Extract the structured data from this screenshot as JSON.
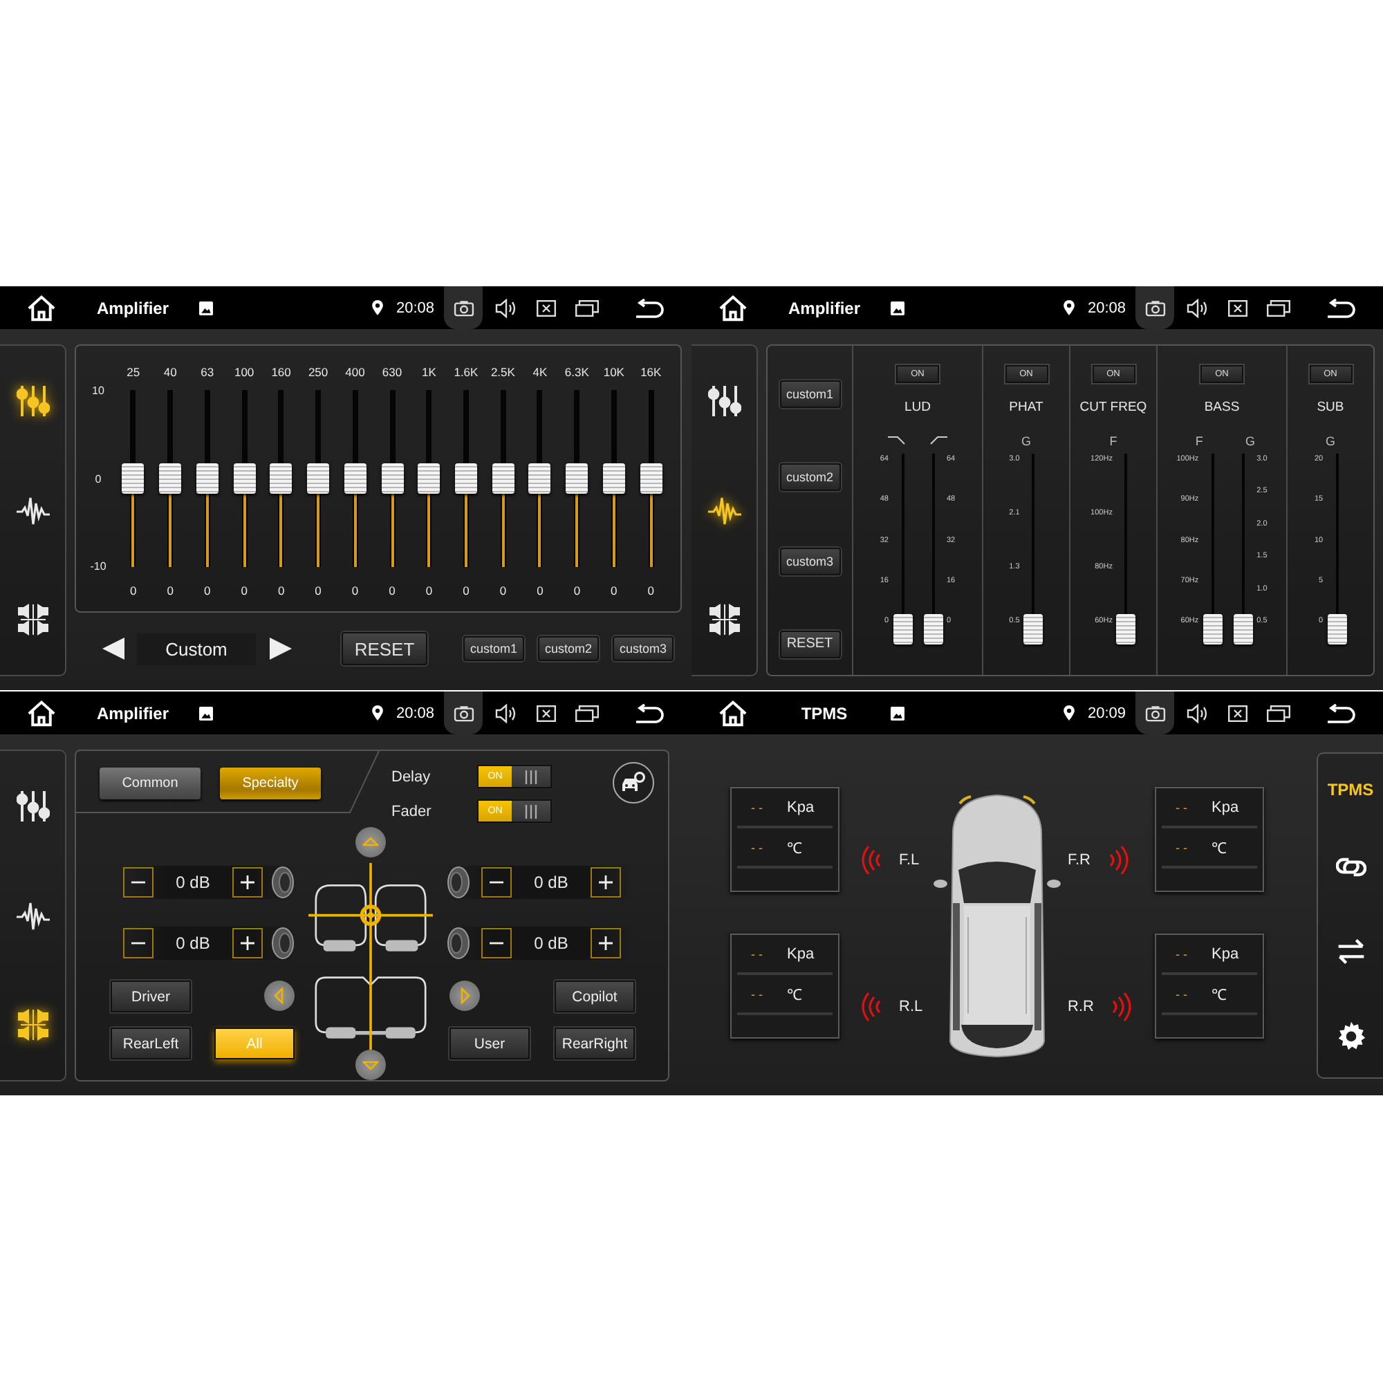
{
  "screens": [
    {
      "kind": "equalizer",
      "status_bar": {
        "title": "Amplifier",
        "time": "20:08"
      },
      "side_tabs": [
        {
          "kind": "sliders",
          "selected": true
        },
        {
          "kind": "waveform",
          "selected": false
        },
        {
          "kind": "balance",
          "selected": false
        }
      ],
      "scale": [
        "10",
        "0",
        "-10"
      ],
      "bands": [
        {
          "freq": "25",
          "value": "0",
          "level": 0.5
        },
        {
          "freq": "40",
          "value": "0",
          "level": 0.5
        },
        {
          "freq": "63",
          "value": "0",
          "level": 0.5
        },
        {
          "freq": "100",
          "value": "0",
          "level": 0.5
        },
        {
          "freq": "160",
          "value": "0",
          "level": 0.5
        },
        {
          "freq": "250",
          "value": "0",
          "level": 0.5
        },
        {
          "freq": "400",
          "value": "0",
          "level": 0.5
        },
        {
          "freq": "630",
          "value": "0",
          "level": 0.5
        },
        {
          "freq": "1K",
          "value": "0",
          "level": 0.5
        },
        {
          "freq": "1.6K",
          "value": "0",
          "level": 0.5
        },
        {
          "freq": "2.5K",
          "value": "0",
          "level": 0.5
        },
        {
          "freq": "4K",
          "value": "0",
          "level": 0.5
        },
        {
          "freq": "6.3K",
          "value": "0",
          "level": 0.5
        },
        {
          "freq": "10K",
          "value": "0",
          "level": 0.5
        },
        {
          "freq": "16K",
          "value": "0",
          "level": 0.5
        }
      ],
      "preset": "Custom",
      "buttons": [
        {
          "label": "RESET",
          "kind": "large"
        },
        {
          "label": "custom1",
          "kind": "small"
        },
        {
          "label": "custom2",
          "kind": "small"
        },
        {
          "label": "custom3",
          "kind": "small"
        }
      ]
    },
    {
      "kind": "amplifier",
      "status_bar": {
        "title": "Amplifier",
        "time": "20:08"
      },
      "side_tabs": [
        {
          "kind": "sliders",
          "selected": false
        },
        {
          "kind": "waveform",
          "selected": true
        },
        {
          "kind": "balance",
          "selected": false
        }
      ],
      "presets": [
        "custom1",
        "custom2",
        "custom3",
        "RESET"
      ],
      "channels": [
        {
          "toggle": "ON",
          "name": "LUD",
          "sliders": [
            {
              "kind": "left",
              "header": {
                "kind": "curve_down"
              },
              "ticks": [
                "64",
                "48",
                "32",
                "16",
                "0"
              ],
              "level": 0
            },
            {
              "kind": "right",
              "header": {
                "kind": "curve_up"
              },
              "ticks": [
                "64",
                "48",
                "32",
                "16",
                "0"
              ],
              "level": 0
            }
          ]
        },
        {
          "toggle": "ON",
          "name": "PHAT",
          "sliders": [
            {
              "kind": "left",
              "header": {
                "kind": "text",
                "text": "G"
              },
              "ticks": [
                "3.0",
                "2.1",
                "1.3",
                "0.5"
              ],
              "level": 0
            }
          ]
        },
        {
          "toggle": "ON",
          "name": "CUT FREQ",
          "sliders": [
            {
              "kind": "left",
              "header": {
                "kind": "text",
                "text": "F"
              },
              "ticks": [
                "120Hz",
                "100Hz",
                "80Hz",
                "60Hz"
              ],
              "level": 0
            }
          ]
        },
        {
          "toggle": "ON",
          "name": "BASS",
          "sliders": [
            {
              "kind": "left",
              "header": {
                "kind": "text",
                "text": "F"
              },
              "ticks": [
                "100Hz",
                "90Hz",
                "80Hz",
                "70Hz",
                "60Hz"
              ],
              "level": 0
            },
            {
              "kind": "right",
              "header": {
                "kind": "text",
                "text": "G"
              },
              "ticks": [
                "3.0",
                "2.5",
                "2.0",
                "1.5",
                "1.0",
                "0.5"
              ],
              "level": 0
            }
          ]
        },
        {
          "toggle": "ON",
          "name": "SUB",
          "sliders": [
            {
              "kind": "left",
              "header": {
                "kind": "text",
                "text": "G"
              },
              "ticks": [
                "20",
                "15",
                "10",
                "5",
                "0"
              ],
              "level": 0
            }
          ]
        }
      ]
    },
    {
      "kind": "balance",
      "status_bar": {
        "title": "Amplifier",
        "time": "20:08"
      },
      "side_tabs": [
        {
          "kind": "sliders",
          "selected": false
        },
        {
          "kind": "waveform",
          "selected": false
        },
        {
          "kind": "balance",
          "selected": true
        }
      ],
      "modes": [
        {
          "label": "Common",
          "selected": false
        },
        {
          "label": "Specialty",
          "selected": true
        }
      ],
      "toggles": [
        {
          "label": "Delay",
          "state": "ON",
          "on": true
        },
        {
          "label": "Fader",
          "state": "ON",
          "on": true
        }
      ],
      "gains": [
        {
          "value": "0 dB"
        },
        {
          "value": "0 dB"
        },
        {
          "value": "0 dB"
        },
        {
          "value": "0 dB"
        }
      ],
      "positions": [
        {
          "label": "Driver",
          "selected": false
        },
        {
          "label": "Copilot",
          "selected": false
        },
        {
          "label": "RearLeft",
          "selected": false
        },
        {
          "label": "All",
          "selected": true
        },
        {
          "label": "User",
          "selected": false
        },
        {
          "label": "RearRight",
          "selected": false
        }
      ]
    },
    {
      "kind": "tpms",
      "status_bar": {
        "title": "TPMS",
        "time": "20:09"
      },
      "tires": [
        {
          "label": "F.L",
          "pressure": "- -",
          "pressure_unit": "Kpa",
          "temperature": "- -",
          "temperature_unit": "℃"
        },
        {
          "label": "F.R",
          "pressure": "- -",
          "pressure_unit": "Kpa",
          "temperature": "- -",
          "temperature_unit": "℃"
        },
        {
          "label": "R.L",
          "pressure": "- -",
          "pressure_unit": "Kpa",
          "temperature": "- -",
          "temperature_unit": "℃"
        },
        {
          "label": "R.R",
          "pressure": "- -",
          "pressure_unit": "Kpa",
          "temperature": "- -",
          "temperature_unit": "℃"
        }
      ],
      "side_menu": [
        {
          "kind": "text",
          "label": "TPMS",
          "selected": true
        },
        {
          "kind": "link",
          "selected": false
        },
        {
          "kind": "swap",
          "selected": false
        },
        {
          "kind": "settings",
          "selected": false
        }
      ]
    }
  ]
}
